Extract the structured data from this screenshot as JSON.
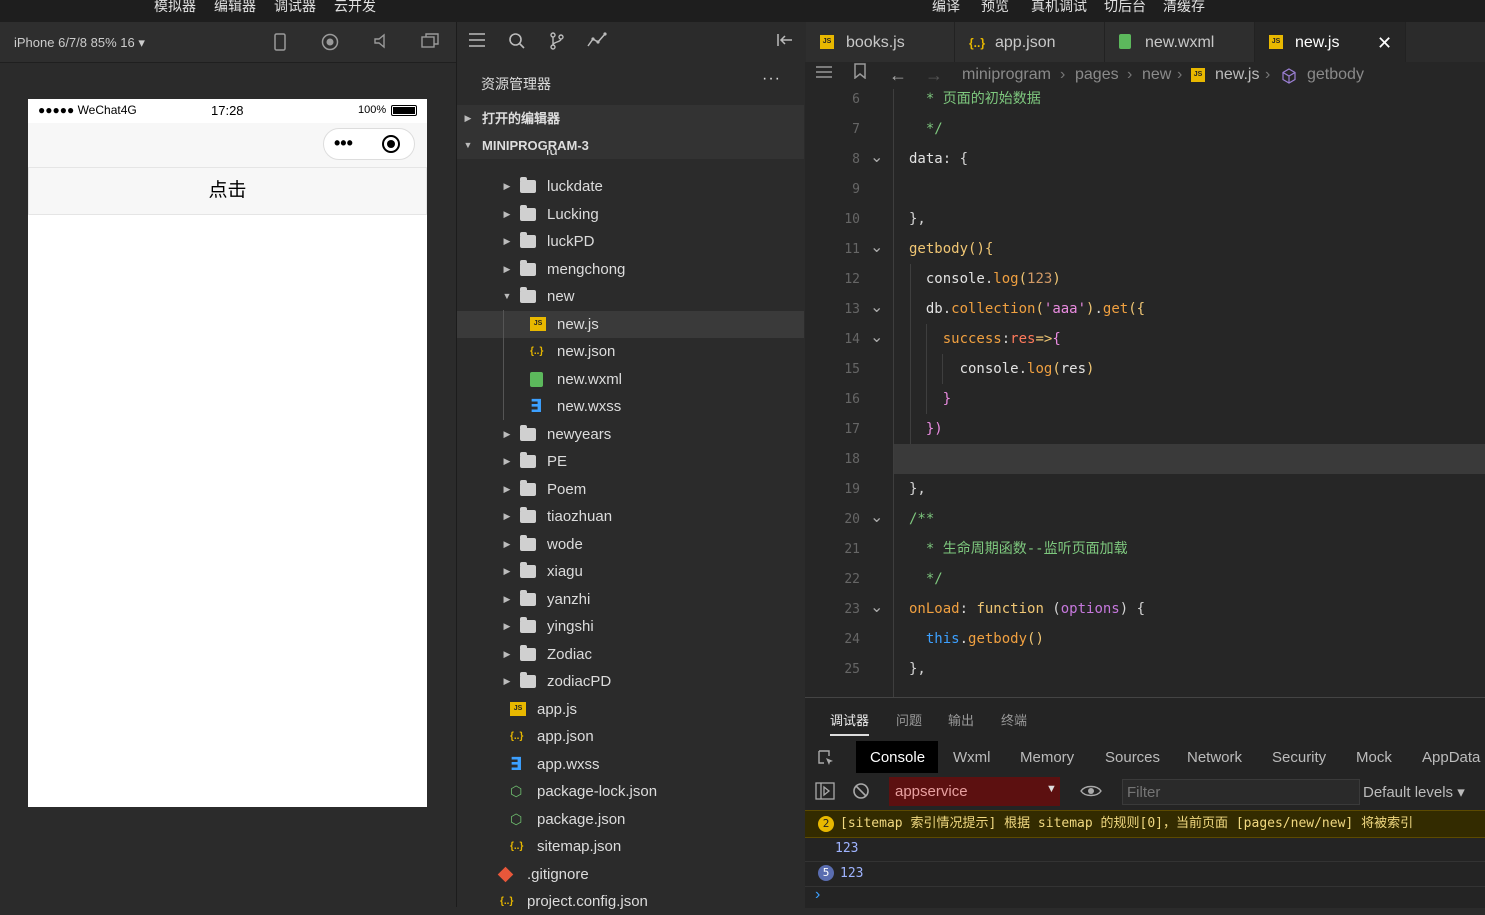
{
  "top_menu": {
    "left": [
      "模拟器",
      "编辑器",
      "调试器",
      "云开发"
    ],
    "right": [
      "编译",
      "预览",
      "真机调试",
      "切后台",
      "清缓存"
    ]
  },
  "simulator": {
    "device_label": "iPhone 6/7/8 85% 16 ▾",
    "status_carrier": "●●●●● WeChat4G",
    "status_time": "17:28",
    "status_battery": "100%",
    "button_label": "点击"
  },
  "explorer": {
    "title": "资源管理器",
    "more": "···",
    "section_open_editors": "打开的编辑器",
    "section_project": "MINIPROGRAM-3",
    "partial_item": "lu",
    "items": [
      {
        "name": "luckdate",
        "type": "folder",
        "expanded": false
      },
      {
        "name": "Lucking",
        "type": "folder",
        "expanded": false
      },
      {
        "name": "luckPD",
        "type": "folder",
        "expanded": false
      },
      {
        "name": "mengchong",
        "type": "folder",
        "expanded": false
      },
      {
        "name": "new",
        "type": "folder",
        "expanded": true
      },
      {
        "name": "new.js",
        "type": "js",
        "selected": true
      },
      {
        "name": "new.json",
        "type": "json"
      },
      {
        "name": "new.wxml",
        "type": "wxml"
      },
      {
        "name": "new.wxss",
        "type": "wxss"
      },
      {
        "name": "newyears",
        "type": "folder",
        "expanded": false
      },
      {
        "name": "PE",
        "type": "folder",
        "expanded": false
      },
      {
        "name": "Poem",
        "type": "folder",
        "expanded": false
      },
      {
        "name": "tiaozhuan",
        "type": "folder",
        "expanded": false
      },
      {
        "name": "wode",
        "type": "folder",
        "expanded": false
      },
      {
        "name": "xiagu",
        "type": "folder",
        "expanded": false
      },
      {
        "name": "yanzhi",
        "type": "folder",
        "expanded": false
      },
      {
        "name": "yingshi",
        "type": "folder",
        "expanded": false
      },
      {
        "name": "Zodiac",
        "type": "folder",
        "expanded": false
      },
      {
        "name": "zodiacPD",
        "type": "folder",
        "expanded": false
      },
      {
        "name": "app.js",
        "type": "js"
      },
      {
        "name": "app.json",
        "type": "json"
      },
      {
        "name": "app.wxss",
        "type": "wxss"
      },
      {
        "name": "package-lock.json",
        "type": "npm"
      },
      {
        "name": "package.json",
        "type": "npm"
      },
      {
        "name": "sitemap.json",
        "type": "json"
      },
      {
        "name": ".gitignore",
        "type": "git"
      },
      {
        "name": "project.config.json",
        "type": "json"
      }
    ]
  },
  "editor": {
    "tabs": [
      {
        "label": "books.js",
        "icon": "js-file-icon",
        "active": false
      },
      {
        "label": "app.json",
        "icon": "json-file-icon",
        "active": false
      },
      {
        "label": "new.wxml",
        "icon": "wxml-file-icon",
        "active": false
      },
      {
        "label": "new.js",
        "icon": "js-file-icon",
        "active": true
      }
    ],
    "close_glyph": "✕",
    "breadcrumb": [
      "miniprogram",
      "pages",
      "new",
      "new.js",
      "getbody"
    ],
    "lines": [
      {
        "n": "6",
        "fold": false,
        "tokens": [
          [
            "  * 页面的初始数据",
            "#7ec87e"
          ]
        ]
      },
      {
        "n": "7",
        "fold": false,
        "tokens": [
          [
            "  */",
            "#7ec87e"
          ]
        ]
      },
      {
        "n": "8",
        "fold": true,
        "tokens": [
          [
            "data",
            "#e2e2e2"
          ],
          [
            ": {",
            "#d4d4d4"
          ]
        ]
      },
      {
        "n": "9",
        "fold": false,
        "tokens": []
      },
      {
        "n": "10",
        "fold": false,
        "tokens": [
          [
            "},",
            "#d4d4d4"
          ]
        ]
      },
      {
        "n": "11",
        "fold": true,
        "tokens": [
          [
            "getbody",
            "#f0c674"
          ],
          [
            "(){",
            "#f0c674"
          ]
        ]
      },
      {
        "n": "12",
        "fold": false,
        "tokens": [
          [
            "  console",
            "#e2e2e2"
          ],
          [
            ".",
            "#d4d4d4"
          ],
          [
            "log",
            "#f0a040"
          ],
          [
            "(",
            "#f0c674"
          ],
          [
            "123",
            "#d19a66"
          ],
          [
            ")",
            "#f0c674"
          ]
        ]
      },
      {
        "n": "13",
        "fold": true,
        "tokens": [
          [
            "  db",
            "#e2e2e2"
          ],
          [
            ".",
            "#d4d4d4"
          ],
          [
            "collection",
            "#f0a040"
          ],
          [
            "(",
            "#f0c674"
          ],
          [
            "'aaa'",
            "#e98be0"
          ],
          [
            ")",
            "#f0c674"
          ],
          [
            ".",
            "#d4d4d4"
          ],
          [
            "get",
            "#f0a040"
          ],
          [
            "({",
            "#f0c674"
          ]
        ]
      },
      {
        "n": "14",
        "fold": true,
        "tokens": [
          [
            "    success",
            "#f0a040"
          ],
          [
            ":",
            "#d4d4d4"
          ],
          [
            "res",
            "#ff7a5c"
          ],
          [
            "=>",
            "#f0c674"
          ],
          [
            "{",
            "#e98be0"
          ]
        ]
      },
      {
        "n": "15",
        "fold": false,
        "tokens": [
          [
            "      console",
            "#e2e2e2"
          ],
          [
            ".",
            "#d4d4d4"
          ],
          [
            "log",
            "#f0a040"
          ],
          [
            "(",
            "#f0c674"
          ],
          [
            "res",
            "#e2e2e2"
          ],
          [
            ")",
            "#f0c674"
          ]
        ]
      },
      {
        "n": "16",
        "fold": false,
        "tokens": [
          [
            "    }",
            "#e98be0"
          ]
        ]
      },
      {
        "n": "17",
        "fold": false,
        "tokens": [
          [
            "  })",
            "#e98be0"
          ]
        ]
      },
      {
        "n": "18",
        "fold": false,
        "tokens": []
      },
      {
        "n": "19",
        "fold": false,
        "tokens": [
          [
            "},",
            "#d4d4d4"
          ]
        ]
      },
      {
        "n": "20",
        "fold": true,
        "tokens": [
          [
            "/**",
            "#7ec87e"
          ]
        ]
      },
      {
        "n": "21",
        "fold": false,
        "tokens": [
          [
            "  * 生命周期函数--监听页面加载",
            "#7ec87e"
          ]
        ]
      },
      {
        "n": "22",
        "fold": false,
        "tokens": [
          [
            "  */",
            "#7ec87e"
          ]
        ]
      },
      {
        "n": "23",
        "fold": true,
        "tokens": [
          [
            "onLoad",
            "#f0a040"
          ],
          [
            ": ",
            "#d4d4d4"
          ],
          [
            "function",
            "#f0c674"
          ],
          [
            " (",
            "#d4d4d4"
          ],
          [
            "options",
            "#c678dd"
          ],
          [
            ") {",
            "#d4d4d4"
          ]
        ]
      },
      {
        "n": "24",
        "fold": false,
        "tokens": [
          [
            "  this",
            "#3ca0ff"
          ],
          [
            ".",
            "#d4d4d4"
          ],
          [
            "getbody",
            "#f0a040"
          ],
          [
            "()",
            "#f0c674"
          ]
        ]
      },
      {
        "n": "25",
        "fold": false,
        "tokens": [
          [
            "},",
            "#d4d4d4"
          ]
        ]
      }
    ]
  },
  "debugger": {
    "panel_tabs": [
      "调试器",
      "问题",
      "输出",
      "终端"
    ],
    "console_tabs": [
      "Console",
      "Wxml",
      "Memory",
      "Sources",
      "Network",
      "Security",
      "Mock",
      "AppData"
    ],
    "context_select": "appservice",
    "filter_placeholder": "Filter",
    "levels": "Default levels ▾",
    "warning_count": "2",
    "warning_text": "[sitemap 索引情况提示] 根据 sitemap 的规则[0]，当前页面 [pages/new/new] 将被索引",
    "log1": "123",
    "log2_count": "5",
    "log2": "123",
    "prompt": "›"
  }
}
